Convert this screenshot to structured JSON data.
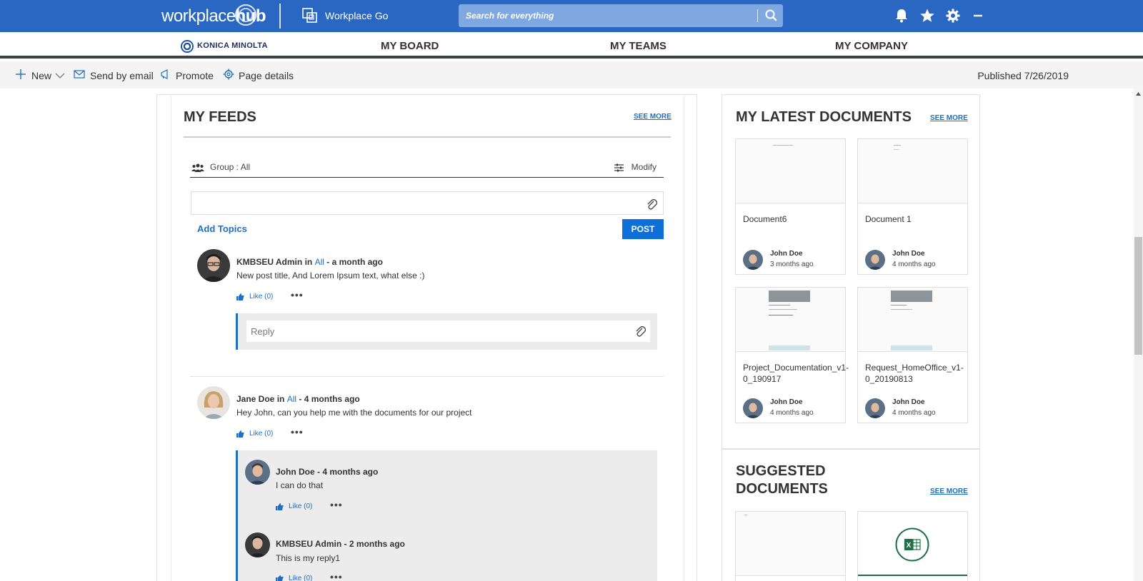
{
  "topbar": {
    "logo_light": "workplace",
    "logo_bold": "hub",
    "app_name": "Workplace Go",
    "search_placeholder": "Search for everything",
    "icons": [
      "bell-icon",
      "star-icon",
      "gear-icon",
      "minimize-icon"
    ]
  },
  "nav": {
    "brand": "KONICA MINOLTA",
    "items": [
      "MY BOARD",
      "MY TEAMS",
      "MY COMPANY"
    ]
  },
  "commandbar": {
    "new": "New",
    "send_by_email": "Send by email",
    "promote": "Promote",
    "page_details": "Page details",
    "published": "Published 7/26/2019"
  },
  "feeds": {
    "title": "MY FEEDS",
    "see_more": "SEE MORE",
    "group": "Group : All",
    "modify": "Modify",
    "add_topics": "Add Topics",
    "post": "POST",
    "reply_placeholder": "Reply",
    "posts": [
      {
        "author": "KMBSEU Admin",
        "in": "in",
        "group": "All",
        "time": "- a month ago",
        "text": "New post title, And Lorem Ipsum text, what else :)",
        "like": "Like (0)"
      },
      {
        "author": "Jane Doe",
        "in": "in",
        "group": "All",
        "time": "- 4 months ago",
        "text": "Hey John, can you help me with the documents for our project",
        "like": "Like (0)"
      }
    ],
    "replies": [
      {
        "header": "John Doe - 4 months ago",
        "text": "I can do that",
        "like": "Like (0)"
      },
      {
        "header": "KMBSEU Admin - 2 months ago",
        "text": "This is my reply1",
        "like": "Like (0)"
      }
    ]
  },
  "latest_docs": {
    "title": "MY LATEST DOCUMENTS",
    "see_more": "SEE MORE",
    "items": [
      {
        "name": "Document6",
        "author": "John Doe",
        "time": "3 months ago"
      },
      {
        "name": "Document 1",
        "author": "John Doe",
        "time": "4 months ago"
      },
      {
        "name": "Project_Documentation_v1-0_190917",
        "author": "John Doe",
        "time": "4 months ago"
      },
      {
        "name": "Request_HomeOffice_v1-0_20190813",
        "author": "John Doe",
        "time": "4 months ago"
      }
    ]
  },
  "suggested": {
    "title_line1": "SUGGESTED",
    "title_line2": "DOCUMENTS",
    "see_more": "SEE MORE"
  },
  "colors": {
    "topbar": "#2a67c2",
    "accent": "#1e6ec1",
    "post_button": "#0f6fd8",
    "excel": "#1d7145"
  }
}
